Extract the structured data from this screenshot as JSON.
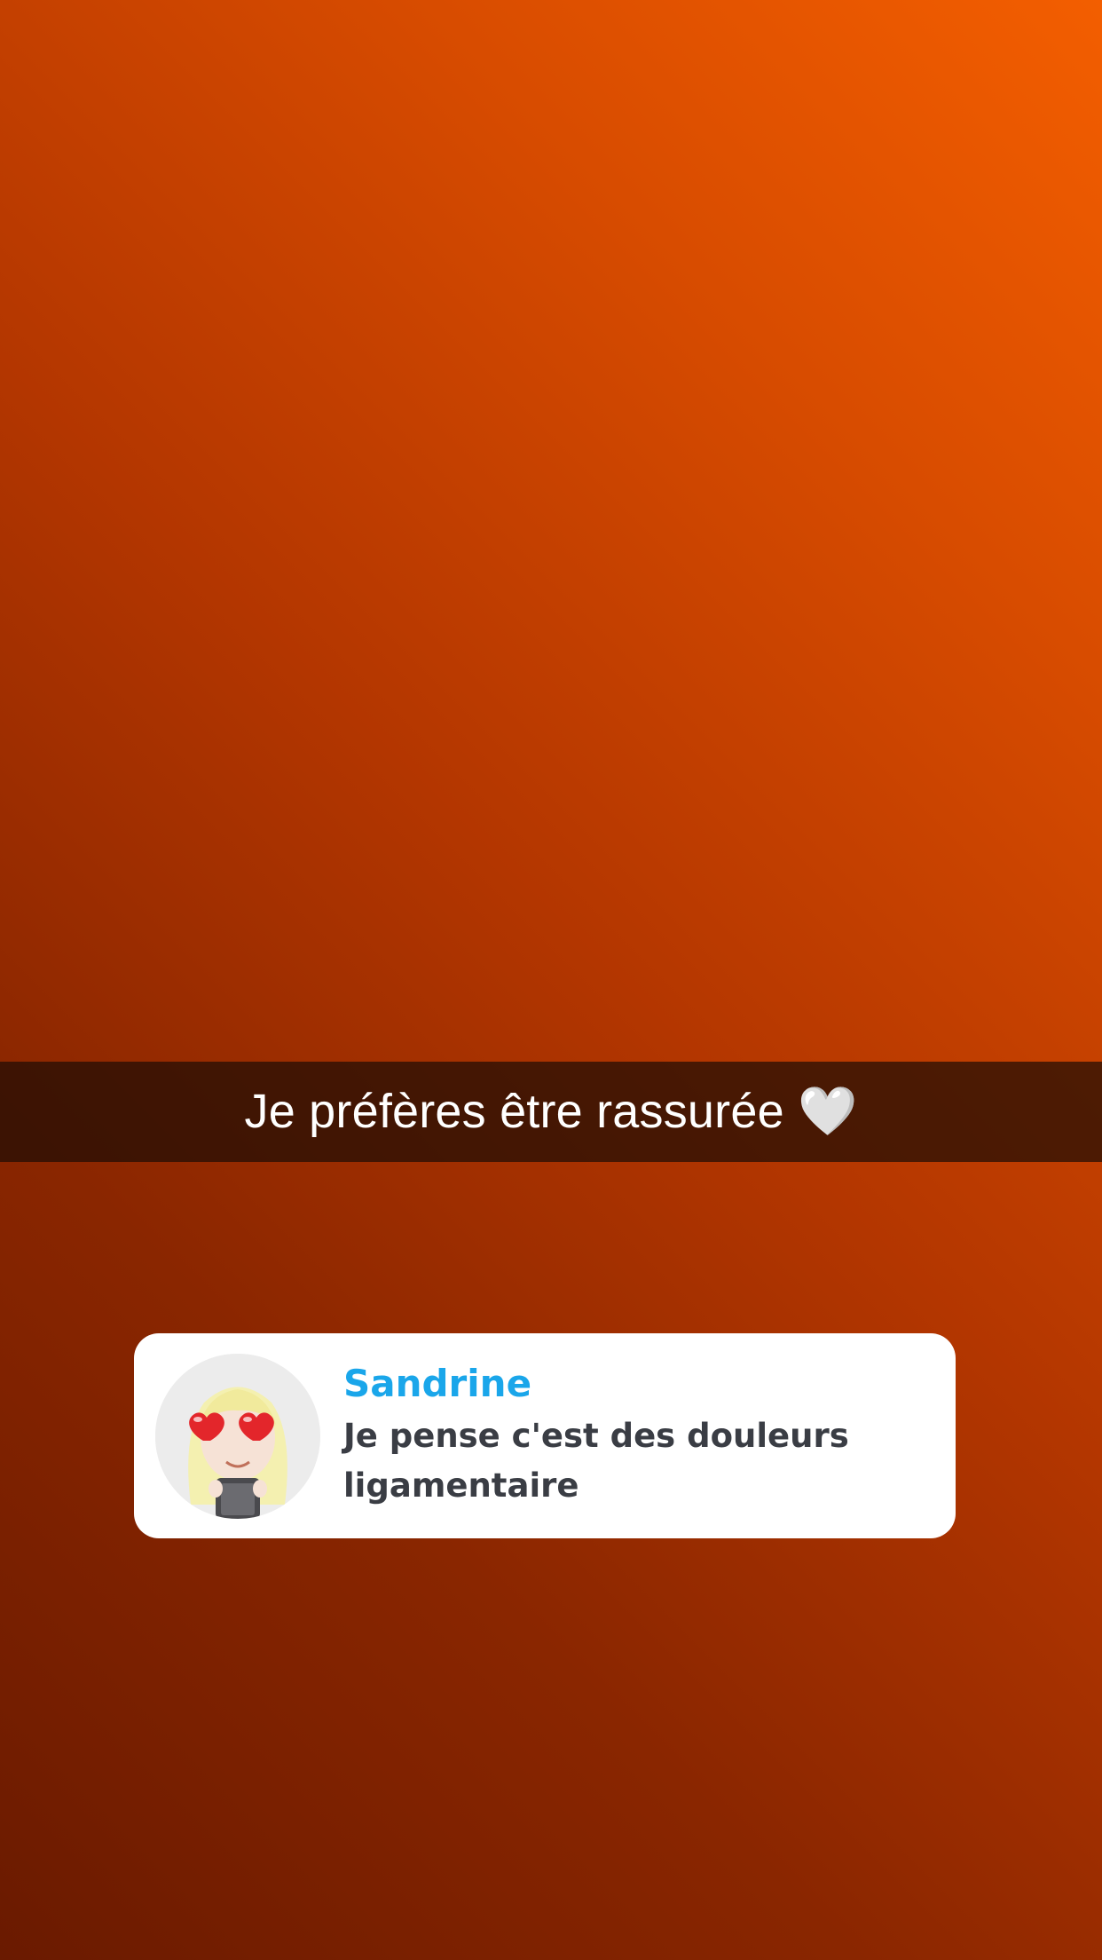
{
  "story": {
    "caption": "Je préfères être rassurée 🤍",
    "background_colors": [
      "#f35e00",
      "#b33600",
      "#6a1a00"
    ]
  },
  "reply_card": {
    "sender_name": "Sandrine",
    "message": "Je pense c'est des douleurs ligamentaire",
    "avatar_icon": "bitmoji-heart-eyes-avatar",
    "name_color": "#1aa6ea"
  }
}
